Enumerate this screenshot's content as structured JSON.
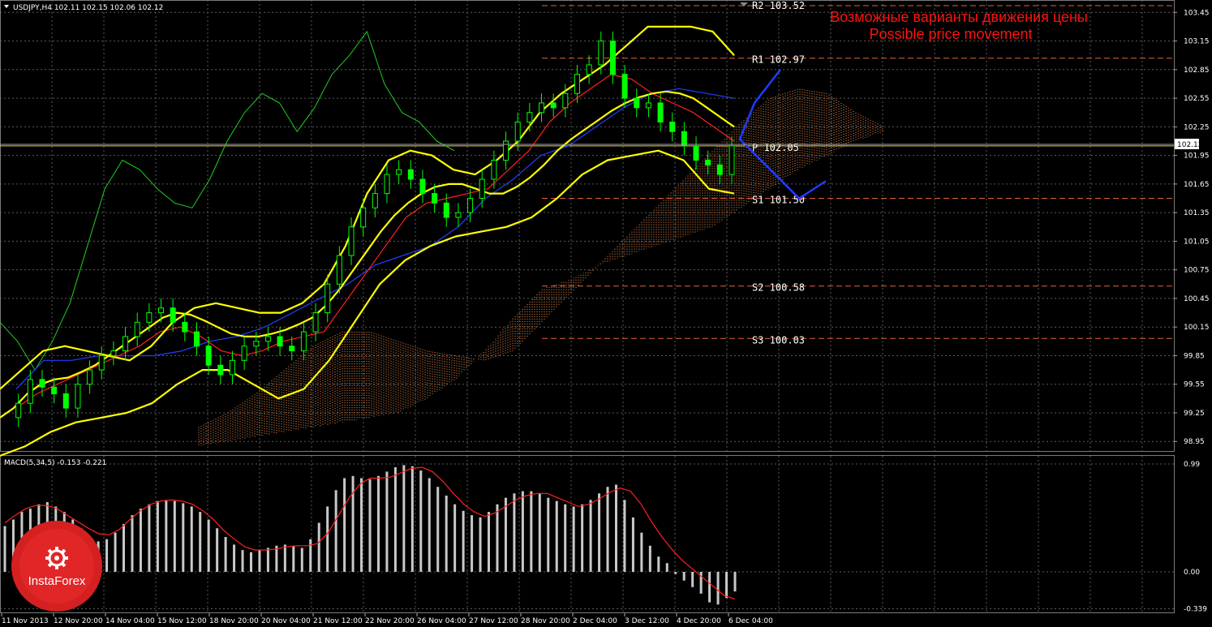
{
  "header": {
    "symbol_info": "USDJPY,H4  102.11 102.15 102.06 102.12"
  },
  "macd_label": "MACD(5,34,5) -0.153 -0.221",
  "annotation": {
    "line1": "Возможные варианты движения цены",
    "line2": "Possible price movement"
  },
  "logo": {
    "text": "InstaForex"
  },
  "colors": {
    "background": "#000000",
    "grid": "#5a5a5a",
    "candle": "#00ff00",
    "ma": "#ffff00",
    "tenkan": "#ff2020",
    "kijun": "#2040ff",
    "chikou": "#22cc22",
    "cloud": "#ff9a5a",
    "levels": "#e0623a",
    "forecast": "#1e3cff",
    "macd_hist": "#c8c8c8",
    "macd_signal": "#ff2020",
    "annotation": "#ff1111"
  },
  "chart_data": [
    {
      "type": "candlestick",
      "title": "USDJPY,H4",
      "ohlc_last": {
        "open": 102.11,
        "high": 102.15,
        "low": 102.06,
        "close": 102.12
      },
      "current_price": 102.12,
      "ylim": [
        98.85,
        103.58
      ],
      "y_ticks": [
        "103.45",
        "103.15",
        "102.85",
        "102.55",
        "102.25",
        "101.95",
        "101.65",
        "101.35",
        "101.05",
        "100.75",
        "100.45",
        "100.15",
        "99.85",
        "99.55",
        "99.25",
        "98.95"
      ],
      "x_ticks": [
        "11 Nov 2013",
        "12 Nov 20:00",
        "14 Nov 04:00",
        "15 Nov 12:00",
        "18 Nov 20:00",
        "20 Nov 04:00",
        "21 Nov 12:00",
        "22 Nov 20:00",
        "26 Nov 04:00",
        "27 Nov 12:00",
        "28 Nov 20:00",
        "2 Dec 04:00",
        "3 Dec 12:00",
        "4 Dec 20:00",
        "6 Dec 04:00"
      ],
      "close_series": [
        99.2,
        99.35,
        99.6,
        99.52,
        99.45,
        99.3,
        99.55,
        99.7,
        99.85,
        99.9,
        100.05,
        100.2,
        100.3,
        100.35,
        100.2,
        100.1,
        99.95,
        99.75,
        99.65,
        99.8,
        99.95,
        100.0,
        100.05,
        99.95,
        99.9,
        100.1,
        100.3,
        100.6,
        100.9,
        101.2,
        101.4,
        101.55,
        101.75,
        101.8,
        101.7,
        101.55,
        101.45,
        101.3,
        101.35,
        101.5,
        101.7,
        101.9,
        102.1,
        102.3,
        102.4,
        102.5,
        102.45,
        102.6,
        102.8,
        102.9,
        103.15,
        102.8,
        102.55,
        102.45,
        102.5,
        102.3,
        102.2,
        102.05,
        101.9,
        101.85,
        101.75,
        102.05
      ],
      "ma_fast": [
        99.2,
        99.3,
        99.45,
        99.55,
        99.6,
        99.62,
        99.68,
        99.75,
        99.85,
        99.95,
        100.05,
        100.15,
        100.25,
        100.3,
        100.28,
        100.22,
        100.15,
        100.08,
        100.05,
        100.05,
        100.08,
        100.12,
        100.18,
        100.25,
        100.38,
        100.55,
        100.75,
        100.95,
        101.15,
        101.32,
        101.45,
        101.55,
        101.62,
        101.65,
        101.65,
        101.6,
        101.55,
        101.55,
        101.62,
        101.72,
        101.85,
        102.0,
        102.12,
        102.22,
        102.32,
        102.42,
        102.5,
        102.56,
        102.6,
        102.62,
        102.6,
        102.55,
        102.45,
        102.35,
        102.25
      ],
      "bollinger_upper": [
        99.5,
        99.7,
        99.9,
        99.95,
        99.9,
        99.85,
        99.8,
        99.95,
        100.2,
        100.35,
        100.4,
        100.35,
        100.3,
        100.3,
        100.4,
        100.6,
        101.0,
        101.55,
        101.9,
        102.0,
        101.95,
        101.8,
        101.75,
        101.9,
        102.1,
        102.4,
        102.6,
        102.75,
        102.9,
        103.1,
        103.3,
        103.3,
        103.3,
        103.25,
        103.0
      ],
      "bollinger_lower": [
        98.8,
        98.9,
        99.05,
        99.15,
        99.2,
        99.25,
        99.35,
        99.55,
        99.7,
        99.7,
        99.55,
        99.4,
        99.5,
        99.8,
        100.2,
        100.6,
        100.85,
        101.0,
        101.1,
        101.15,
        101.2,
        101.3,
        101.5,
        101.75,
        101.9,
        101.95,
        102.0,
        101.9,
        101.6,
        101.55
      ],
      "tenkan": [
        99.3,
        99.45,
        99.55,
        99.65,
        99.75,
        99.85,
        99.95,
        100.1,
        100.15,
        100.05,
        99.9,
        99.85,
        99.9,
        100.0,
        100.05,
        100.1,
        100.4,
        100.7,
        101.0,
        101.3,
        101.45,
        101.5,
        101.55,
        101.6,
        101.8,
        102.0,
        102.3,
        102.5,
        102.65,
        102.8,
        102.75,
        102.6,
        102.5,
        102.4,
        102.25,
        102.1
      ],
      "kijun": [
        99.5,
        99.8,
        99.8,
        99.85,
        99.85,
        99.85,
        99.9,
        100.0,
        100.05,
        100.15,
        100.3,
        100.45,
        100.6,
        100.8,
        100.9,
        101.0,
        101.2,
        101.5,
        101.7,
        101.95,
        102.05,
        102.25,
        102.45,
        102.6,
        102.65,
        102.6,
        102.55
      ],
      "chikou": [
        100.2,
        100.0,
        99.7,
        100.0,
        100.4,
        101.0,
        101.6,
        101.9,
        101.8,
        101.6,
        101.45,
        101.4,
        101.7,
        102.1,
        102.4,
        102.6,
        102.5,
        102.2,
        102.45,
        102.8,
        103.0,
        103.25,
        102.7,
        102.4,
        102.3,
        102.1,
        102.0
      ],
      "ichimoku_cloud_upper": [
        99.1,
        99.25,
        99.45,
        99.7,
        99.95,
        100.1,
        100.1,
        100.0,
        99.9,
        99.85,
        99.8,
        99.9,
        100.2,
        100.5,
        100.8,
        101.1,
        101.4,
        101.7,
        102.0,
        102.3,
        102.55,
        102.65,
        102.6,
        102.4,
        102.25
      ],
      "ichimoku_cloud_lower": [
        98.9,
        98.95,
        99.0,
        99.05,
        99.1,
        99.15,
        99.2,
        99.25,
        99.4,
        99.6,
        99.9,
        100.25,
        100.55,
        100.65,
        100.8,
        100.9,
        101.0,
        101.1,
        101.2,
        101.4,
        101.6,
        101.8,
        101.95,
        102.1,
        102.2
      ],
      "pivot_levels": [
        {
          "name": "R2",
          "value": 103.52,
          "label": "R2 103.52"
        },
        {
          "name": "R1",
          "value": 102.97,
          "label": "R1 102.97"
        },
        {
          "name": "P",
          "value": 102.05,
          "label": "P  102.05"
        },
        {
          "name": "S1",
          "value": 101.5,
          "label": "S1 101.50"
        },
        {
          "name": "S2",
          "value": 100.58,
          "label": "S2 100.58"
        },
        {
          "name": "S3",
          "value": 100.03,
          "label": "S3 100.03"
        }
      ],
      "forecast_paths": [
        {
          "name": "up",
          "points": [
            102.12,
            102.5,
            102.85
          ]
        },
        {
          "name": "down",
          "points": [
            102.12,
            101.5,
            101.68
          ]
        }
      ]
    },
    {
      "type": "bar",
      "title": "MACD(5,34,5)",
      "values_label": "-0.153 -0.221",
      "ylim": [
        -0.4,
        1.02
      ],
      "y_ticks": [
        "0.99",
        "0.00",
        "-0.339"
      ],
      "histogram": [
        0.42,
        0.48,
        0.55,
        0.58,
        0.62,
        0.64,
        0.6,
        0.55,
        0.48,
        0.4,
        0.32,
        0.28,
        0.3,
        0.36,
        0.44,
        0.52,
        0.58,
        0.62,
        0.65,
        0.66,
        0.65,
        0.63,
        0.6,
        0.55,
        0.48,
        0.4,
        0.32,
        0.25,
        0.2,
        0.18,
        0.2,
        0.22,
        0.24,
        0.25,
        0.24,
        0.22,
        0.3,
        0.45,
        0.6,
        0.75,
        0.86,
        0.88,
        0.86,
        0.85,
        0.88,
        0.92,
        0.96,
        0.98,
        0.97,
        0.93,
        0.86,
        0.78,
        0.7,
        0.62,
        0.56,
        0.52,
        0.5,
        0.55,
        0.62,
        0.68,
        0.72,
        0.74,
        0.74,
        0.72,
        0.68,
        0.65,
        0.62,
        0.6,
        0.62,
        0.66,
        0.72,
        0.78,
        0.8,
        0.66,
        0.5,
        0.36,
        0.24,
        0.14,
        0.08,
        -0.02,
        -0.08,
        -0.14,
        -0.2,
        -0.28,
        -0.3,
        -0.24,
        -0.18
      ],
      "signal": [
        0.45,
        0.52,
        0.58,
        0.61,
        0.61,
        0.58,
        0.52,
        0.46,
        0.4,
        0.35,
        0.34,
        0.39,
        0.48,
        0.56,
        0.62,
        0.65,
        0.66,
        0.65,
        0.62,
        0.56,
        0.48,
        0.38,
        0.3,
        0.23,
        0.2,
        0.2,
        0.21,
        0.23,
        0.24,
        0.24,
        0.26,
        0.36,
        0.52,
        0.68,
        0.8,
        0.86,
        0.86,
        0.87,
        0.91,
        0.95,
        0.96,
        0.92,
        0.83,
        0.72,
        0.62,
        0.55,
        0.51,
        0.54,
        0.6,
        0.66,
        0.7,
        0.72,
        0.72,
        0.68,
        0.64,
        0.6,
        0.62,
        0.67,
        0.73,
        0.77,
        0.74,
        0.62,
        0.46,
        0.32,
        0.2,
        0.1,
        0.02,
        -0.06,
        -0.14,
        -0.22,
        -0.25
      ]
    }
  ]
}
